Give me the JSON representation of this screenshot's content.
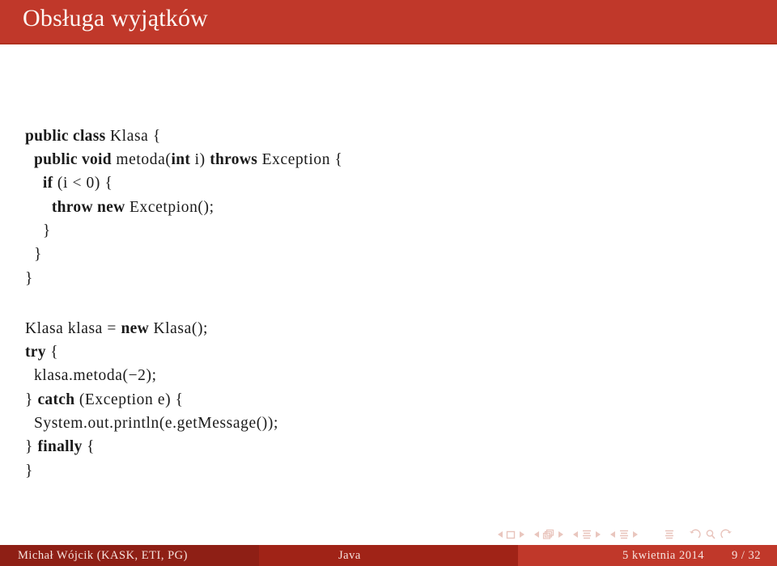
{
  "slide": {
    "title": "Obsługa wyjątków",
    "accent_color": "#c0382a",
    "footer_dark_color": "#8e1f15",
    "footer_mid_color": "#a02317",
    "footer_light_color": "#c0382a",
    "nav_symbol_color": "#e8c3bb"
  },
  "code_blocks": [
    {
      "id": "class-definition",
      "lines": [
        [
          {
            "t": "public class",
            "s": "kw"
          },
          {
            "t": " Klasa {",
            "s": "id"
          }
        ],
        [
          {
            "t": "  ",
            "s": "id"
          },
          {
            "t": "public void",
            "s": "kw"
          },
          {
            "t": " metoda(",
            "s": "id"
          },
          {
            "t": "int",
            "s": "kw"
          },
          {
            "t": " i) ",
            "s": "id"
          },
          {
            "t": "throws",
            "s": "kw"
          },
          {
            "t": " Exception {",
            "s": "id"
          }
        ],
        [
          {
            "t": "    ",
            "s": "id"
          },
          {
            "t": "if",
            "s": "kw"
          },
          {
            "t": " (i < 0) {",
            "s": "id"
          }
        ],
        [
          {
            "t": "      ",
            "s": "id"
          },
          {
            "t": "throw new",
            "s": "kw"
          },
          {
            "t": " Excetpion();",
            "s": "id"
          }
        ],
        [
          {
            "t": "    }",
            "s": "id"
          }
        ],
        [
          {
            "t": "  }",
            "s": "id"
          }
        ],
        [
          {
            "t": "}",
            "s": "id"
          }
        ]
      ]
    },
    {
      "id": "try-catch-finally",
      "lines": [
        [
          {
            "t": "Klasa klasa = ",
            "s": "id"
          },
          {
            "t": "new",
            "s": "kw"
          },
          {
            "t": " Klasa();",
            "s": "id"
          }
        ],
        [
          {
            "t": "try",
            "s": "kw"
          },
          {
            "t": " {",
            "s": "id"
          }
        ],
        [
          {
            "t": "  klasa.metoda(−2);",
            "s": "id"
          }
        ],
        [
          {
            "t": "} ",
            "s": "id"
          },
          {
            "t": "catch",
            "s": "kw"
          },
          {
            "t": " (Exception e) {",
            "s": "id"
          }
        ],
        [
          {
            "t": "  System.out.println(e.getMessage());",
            "s": "id"
          }
        ],
        [
          {
            "t": "} ",
            "s": "id"
          },
          {
            "t": "finally",
            "s": "kw"
          },
          {
            "t": " {",
            "s": "id"
          }
        ],
        [
          {
            "t": "}",
            "s": "id"
          }
        ]
      ]
    }
  ],
  "navigation": {
    "slide_icon": "slide-square-icon",
    "frame_icon": "frame-stack-icon",
    "subsection_icon": "subsection-lines-icon",
    "section_icon": "section-lines-icon",
    "document_icon": "document-lines-icon",
    "back_icon": "back-arrow-icon",
    "search_icon": "search-magnifier-icon",
    "forward_icon": "forward-arrow-icon"
  },
  "footer": {
    "author": "Michał Wójcik  (KASK, ETI, PG)",
    "subject": "Java",
    "date": "5 kwietnia 2014",
    "page": "9 / 32"
  }
}
